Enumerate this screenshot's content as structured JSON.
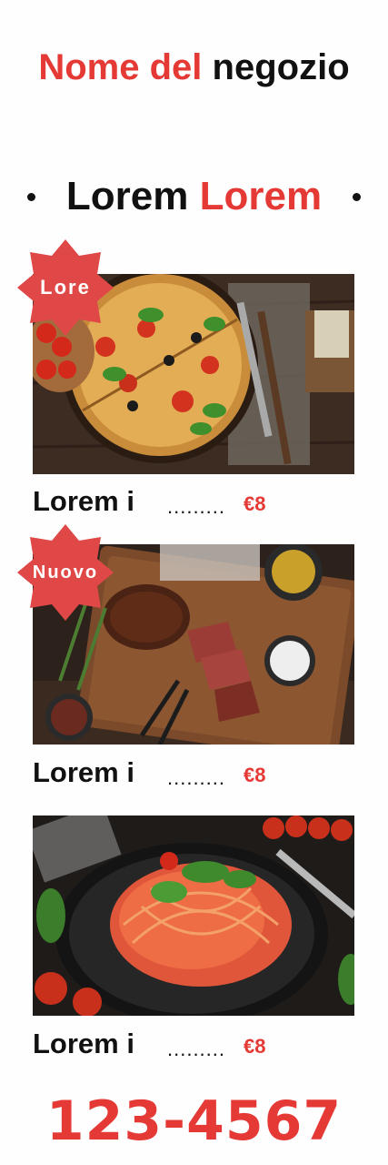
{
  "header": {
    "title_part1": "Nome del",
    "title_part2": "negozio"
  },
  "section": {
    "heading_part1": "Lorem",
    "heading_part2": "Lorem"
  },
  "menu": {
    "items": [
      {
        "name": "Lorem i",
        "dots": ".........",
        "price": "€8",
        "badge": "Lore",
        "image": "pizza"
      },
      {
        "name": "Lorem i",
        "dots": ".........",
        "price": "€8",
        "badge": "Nuovo",
        "image": "steak"
      },
      {
        "name": "Lorem i",
        "dots": ".........",
        "price": "€8",
        "badge": "",
        "image": "spaghetti"
      }
    ]
  },
  "footer": {
    "phone": "123-4567"
  },
  "colors": {
    "accent": "#e53935",
    "text": "#111111",
    "background": "#fefefe"
  }
}
